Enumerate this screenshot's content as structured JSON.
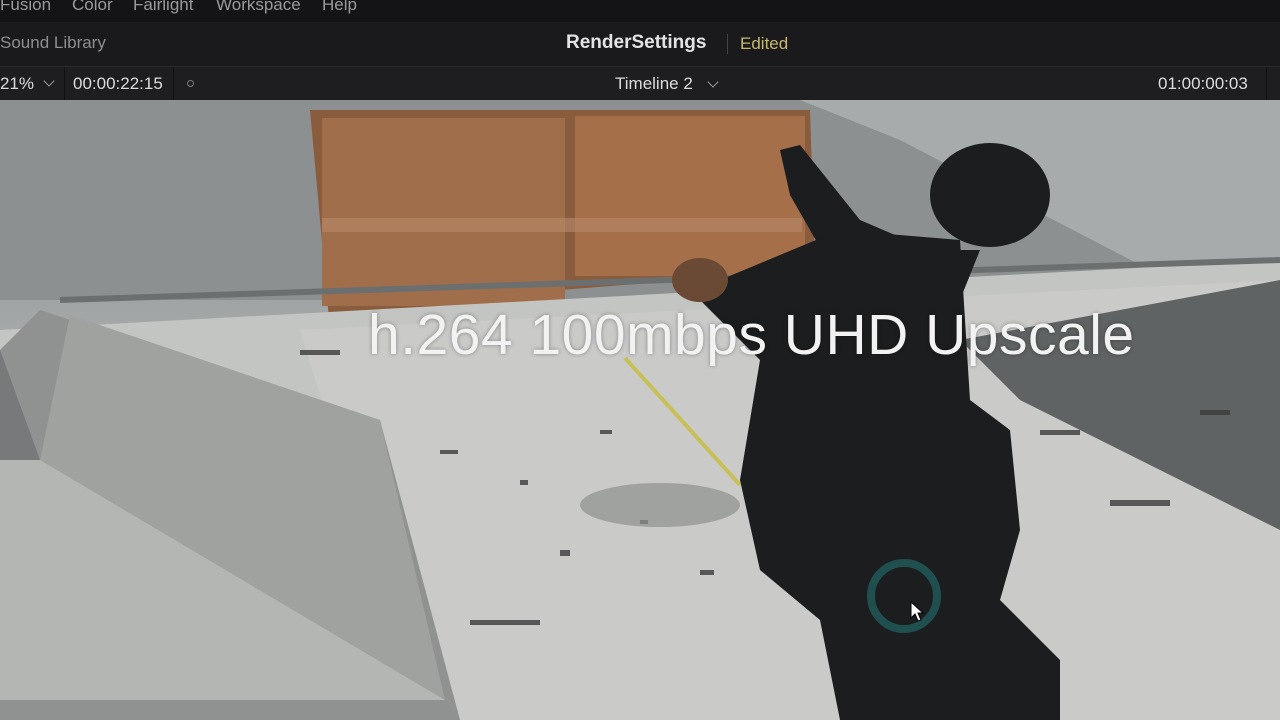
{
  "menu": {
    "items": [
      "Fusion",
      "Color",
      "Fairlight",
      "Workspace",
      "Help"
    ]
  },
  "titlebar": {
    "left_label": "Sound Library",
    "project_title": "RenderSettings",
    "status": "Edited"
  },
  "viewer_toolbar": {
    "zoom": "21%",
    "source_timecode": "00:00:22:15",
    "timeline_name": "Timeline 2",
    "record_timecode": "01:00:00:03"
  },
  "viewer": {
    "overlay_caption": "h.264 100mbps UHD Upscale"
  },
  "colors": {
    "edited_status": "#c5b96a",
    "busy_ring": "#1f4f4f",
    "background": "#1a1a1c"
  },
  "icons": {
    "zoom_dropdown": "chevron-down-icon",
    "timeline_dropdown": "chevron-down-icon",
    "loading": "busy-ring-icon",
    "pointer": "cursor-icon"
  }
}
